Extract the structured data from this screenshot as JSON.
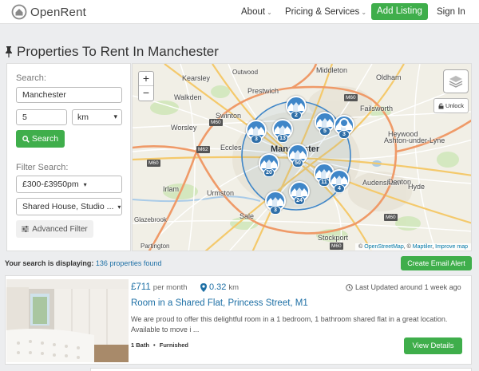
{
  "nav": {
    "logo_text": "OpenRent",
    "about": "About",
    "pricing": "Pricing & Services",
    "add_listing": "Add Listing",
    "sign_in": "Sign In"
  },
  "page_title": "Properties To Rent In Manchester",
  "search": {
    "label": "Search:",
    "location_value": "Manchester",
    "radius_value": "5",
    "radius_unit": "km",
    "search_button": "Search",
    "filter_label": "Filter Search:",
    "price_filter": "£300-£3950pm",
    "type_filter": "Shared House, Studio ...",
    "advanced_filter": "Advanced Filter"
  },
  "map": {
    "zoom_in": "+",
    "zoom_out": "−",
    "unlock": "Unlock",
    "attribution_prefix": "©",
    "attribution_osm": "OpenStreetMap",
    "attribution_sep": ", ©",
    "attribution_maptiler": "Maptiler",
    "attribution_comma": ", ",
    "attribution_improve": "Improve map",
    "place_names": [
      "Kearsley",
      "Outwood",
      "Middleton",
      "Oldham",
      "Prestwich",
      "Walkden",
      "Failsworth",
      "Swinton",
      "Worsley",
      "Manchester",
      "Ashton-under-Lyne",
      "Eccles",
      "Heywood",
      "Audenshaw",
      "Irlam",
      "Urmston",
      "Denton",
      "Hyde",
      "Sale",
      "Glazebrook",
      "Stockport",
      "Partington"
    ],
    "cluster_counts": [
      "2",
      "3",
      "13",
      "5",
      "3",
      "50",
      "20",
      "11",
      "4",
      "24",
      "3"
    ],
    "road_labels": [
      "M60",
      "M62",
      "M60",
      "M60",
      "M60",
      "M60"
    ]
  },
  "results": {
    "prefix": "Your search is displaying:",
    "count_text": "136 properties found",
    "email_alert": "Create Email Alert"
  },
  "listing": {
    "price": "£711",
    "price_period": "per month",
    "distance": "0.32",
    "distance_unit": "km",
    "updated": "Last Updated around 1 week ago",
    "title": "Room in a Shared Flat, Princess Street, M1",
    "description": "We are proud to offer this delightful room in a 1 bedroom, 1 bathroom shared flat in a great location. Available to move i ...",
    "tag_bath": "1 Bath",
    "tag_furnished": "Furnished",
    "view_button": "View Details"
  },
  "colors": {
    "accent_green": "#3fae4b",
    "link_blue": "#1d6fa5",
    "marker_blue": "#3f86c8"
  }
}
